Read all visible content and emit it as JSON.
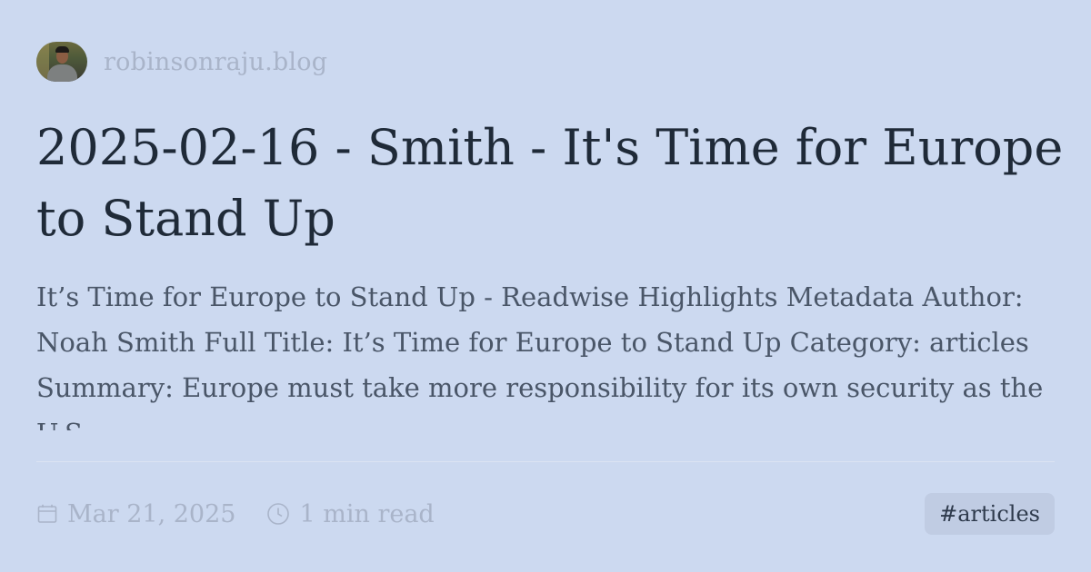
{
  "site": {
    "name": "robinsonraju.blog"
  },
  "post": {
    "title": "2025-02-16 - Smith - It's Time for Europe to Stand Up",
    "description": "It’s Time for Europe to Stand Up - Readwise Highlights Metadata Author: Noah Smith Full Title: It’s Time for Europe to Stand Up Category: articles Summary: Europe must take more responsibility for its own security as the U.S.",
    "date": "Mar 21, 2025",
    "read_time": "1 min read",
    "tag": "#articles"
  },
  "icons": {
    "date": "calendar-icon",
    "read_time": "clock-icon"
  },
  "colors": {
    "background": "#ccd9f0",
    "title": "#1f2a38",
    "description": "#4a5668",
    "muted": "#a9b4c9",
    "tag_background": "#c0cce3"
  }
}
